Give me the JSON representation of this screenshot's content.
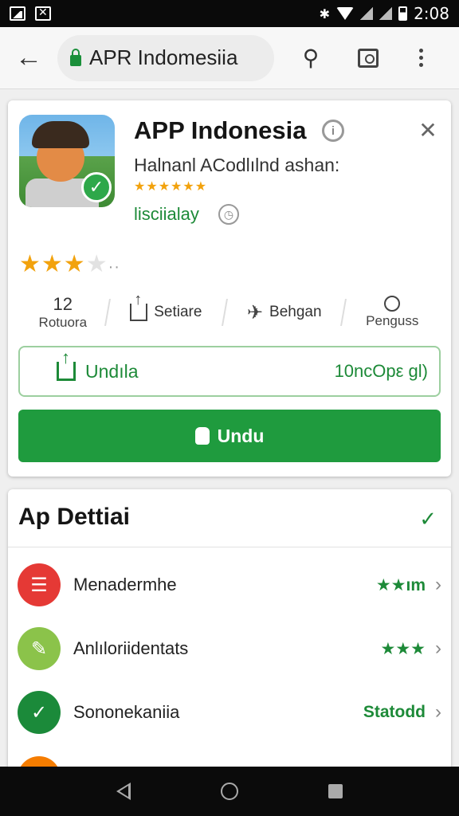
{
  "status_bar": {
    "time": "2:08"
  },
  "browser": {
    "url": "APR Indomesiia"
  },
  "app": {
    "title": "APP Indonesia",
    "subtitle": "Halnanl ACodlılnd ashan:",
    "mini_stars": "★★★★★★",
    "category": "lisciialay",
    "rating_stars": {
      "full": "★★★",
      "empty": "★",
      "more": "··"
    },
    "stats": {
      "reviews_count": "12",
      "reviews_label": "Rotuora",
      "share_label": "Setiare",
      "similar_label": "Behgan",
      "more_label": "Penguss"
    },
    "download": {
      "label": "Undıla",
      "size": "10ncOpε gl)"
    },
    "install_label": "Undu"
  },
  "details": {
    "title": "Ap Dettiai",
    "rows": [
      {
        "label": "Menadermhe",
        "value": "★★ım",
        "icon": "list-icon",
        "color": "#e53935"
      },
      {
        "label": "Anlıloriidentats",
        "value": "★★★",
        "icon": "edit-check-icon",
        "color": "#8bc34a"
      },
      {
        "label": "Sononekaniia",
        "value": "Statodd",
        "icon": "check-icon",
        "color": "#1b8a3a"
      },
      {
        "label": "",
        "value": "",
        "icon": "partial-icon",
        "color": "#f57c00"
      }
    ]
  },
  "colors": {
    "accent_green": "#1f9b3e",
    "star_orange": "#f2a20d"
  }
}
